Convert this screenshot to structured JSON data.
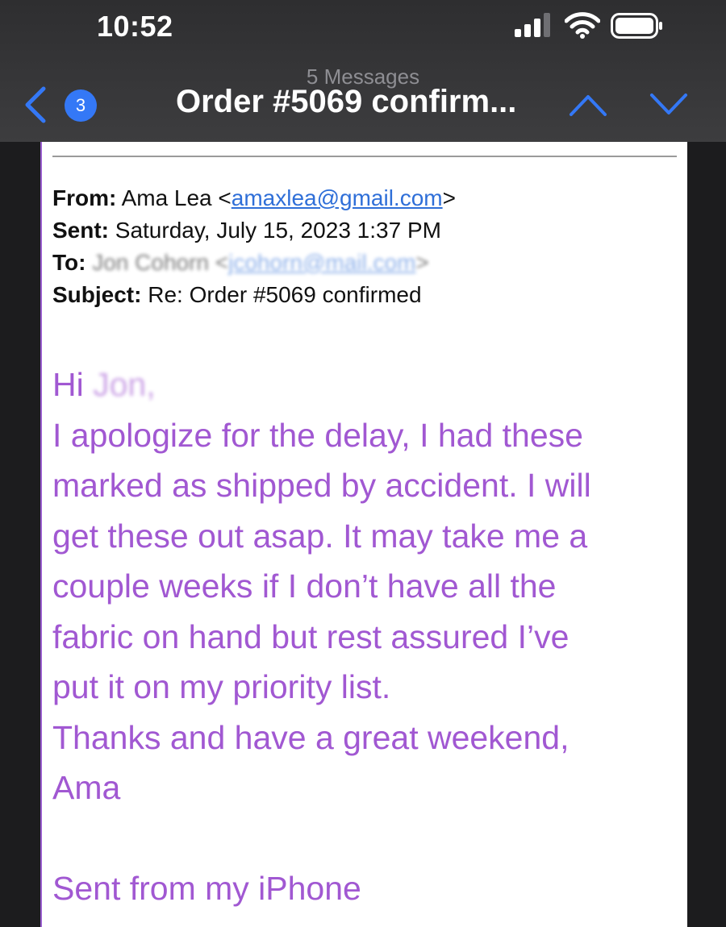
{
  "status_bar": {
    "time": "10:52"
  },
  "nav": {
    "back_badge": "3",
    "message_count": "5 Messages",
    "title": "Order #5069 confirm..."
  },
  "email": {
    "headers": {
      "from_label": "From:",
      "from_name": "Ama Lea <",
      "from_email": "amaxlea@gmail.com",
      "from_close": ">",
      "sent_label": "Sent:",
      "sent_value": "Saturday, July 15, 2023 1:37 PM",
      "to_label": "To:",
      "to_name": "Jon Cohorn <",
      "to_email": "jcohorn@mail.com",
      "to_close": ">",
      "subject_label": "Subject:",
      "subject_value": "Re: Order #5069 confirmed"
    },
    "body": {
      "greeting_prefix": "Hi",
      "greeting_name": "Jon,",
      "lines": [
        "I apologize for the delay, I had these",
        "marked as shipped by accident. I will",
        "get these out asap. It may take me a",
        "couple weeks if I don’t have all the",
        "fabric on hand but rest assured I’ve",
        "put it on my priority list.",
        "Thanks and have a great weekend,",
        "Ama"
      ],
      "signature": "Sent from my iPhone"
    }
  },
  "colors": {
    "body_text": "#a158d2",
    "link": "#2f6fd8",
    "accent_blue": "#3478f6",
    "header_bg": "#3a3a3c"
  }
}
